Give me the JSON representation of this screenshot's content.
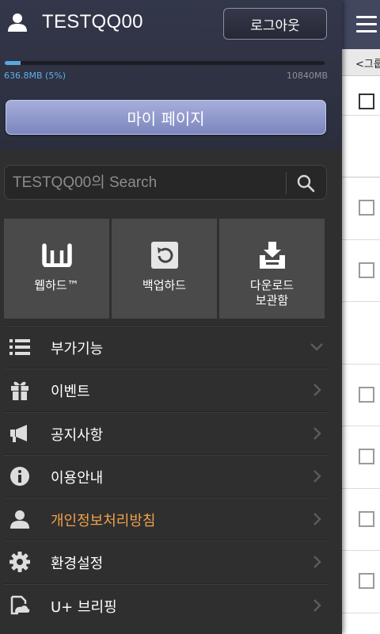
{
  "background_page": {
    "breadcrumb": "<그룹"
  },
  "drawer": {
    "user": {
      "name": "TESTQQ00",
      "logout_label": "로그아웃"
    },
    "storage": {
      "used_label": "636.8MB (5%)",
      "total_label": "10840MB",
      "used_fraction": 0.05
    },
    "mypage_label": "마이 페이지",
    "search": {
      "placeholder": "TESTQQ00의 Search"
    },
    "tiles": [
      {
        "label": "웹하드™",
        "icon": "webhard-icon"
      },
      {
        "label": "백업하드",
        "icon": "backup-icon"
      },
      {
        "label": "다운로드\n보관함",
        "icon": "download-box-icon"
      }
    ],
    "menu": [
      {
        "label": "부가기능",
        "icon": "list-icon",
        "indicator": "chevron-down"
      },
      {
        "label": "이벤트",
        "icon": "gift-icon",
        "indicator": "chevron-right"
      },
      {
        "label": "공지사항",
        "icon": "megaphone-icon",
        "indicator": "chevron-right"
      },
      {
        "label": "이용안내",
        "icon": "info-icon",
        "indicator": "chevron-right"
      },
      {
        "label": "개인정보처리방침",
        "icon": "person-icon",
        "indicator": "chevron-right",
        "highlight": true
      },
      {
        "label": "환경설정",
        "icon": "gear-icon",
        "indicator": "chevron-right"
      },
      {
        "label": "U+ 브리핑",
        "icon": "briefing-icon",
        "indicator": "chevron-right"
      }
    ]
  },
  "colors": {
    "header_bg": "#33374a",
    "drawer_bg": "#2f2f2f",
    "tile_bg": "#4a4a4a",
    "mypage_button": "#8f98cc",
    "usage_fill": "#5aa7e0",
    "highlight_text": "#f0a04b"
  }
}
